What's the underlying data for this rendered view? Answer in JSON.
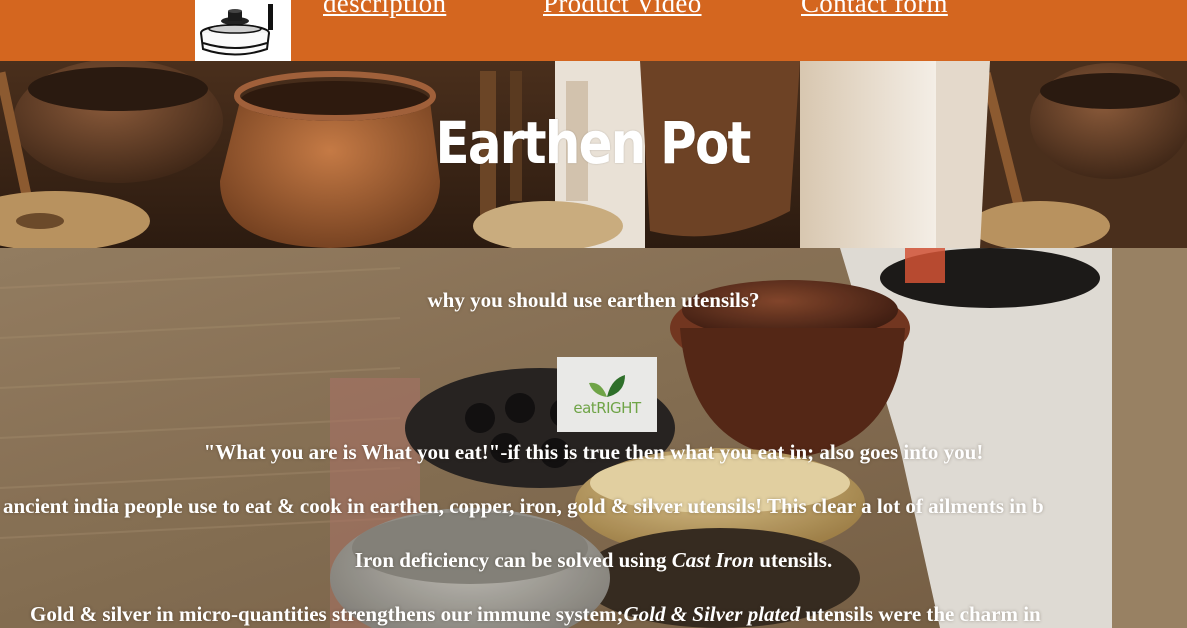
{
  "nav": {
    "logo_icon": "earthen-pot-logo-icon",
    "links": [
      {
        "label": "description"
      },
      {
        "label": "Product Video"
      },
      {
        "label": "Contact form"
      }
    ],
    "background_color": "#d4661f"
  },
  "hero": {
    "title": "Earthen Pot"
  },
  "content": {
    "heading": "why you should use earthen utensils?",
    "badge": {
      "label": "eatRIGHT",
      "icon": "leaf-icon"
    },
    "quote": "\"What you are is What you eat!\"-if this is true then what you eat in; also goes into you!",
    "ancient_india": "ancient india people use to eat & cook in earthen, copper, iron, gold & silver utensils! This clear a lot of ailments in b",
    "iron_prefix": "Iron deficiency can be solved using ",
    "iron_emphasis": "Cast Iron",
    "iron_suffix": " utensils.",
    "gold_prefix": "Gold & silver in micro-quantities strengthens our immune system;",
    "gold_emphasis": "Gold & Silver plated",
    "gold_suffix": " utensils were the charm in"
  }
}
